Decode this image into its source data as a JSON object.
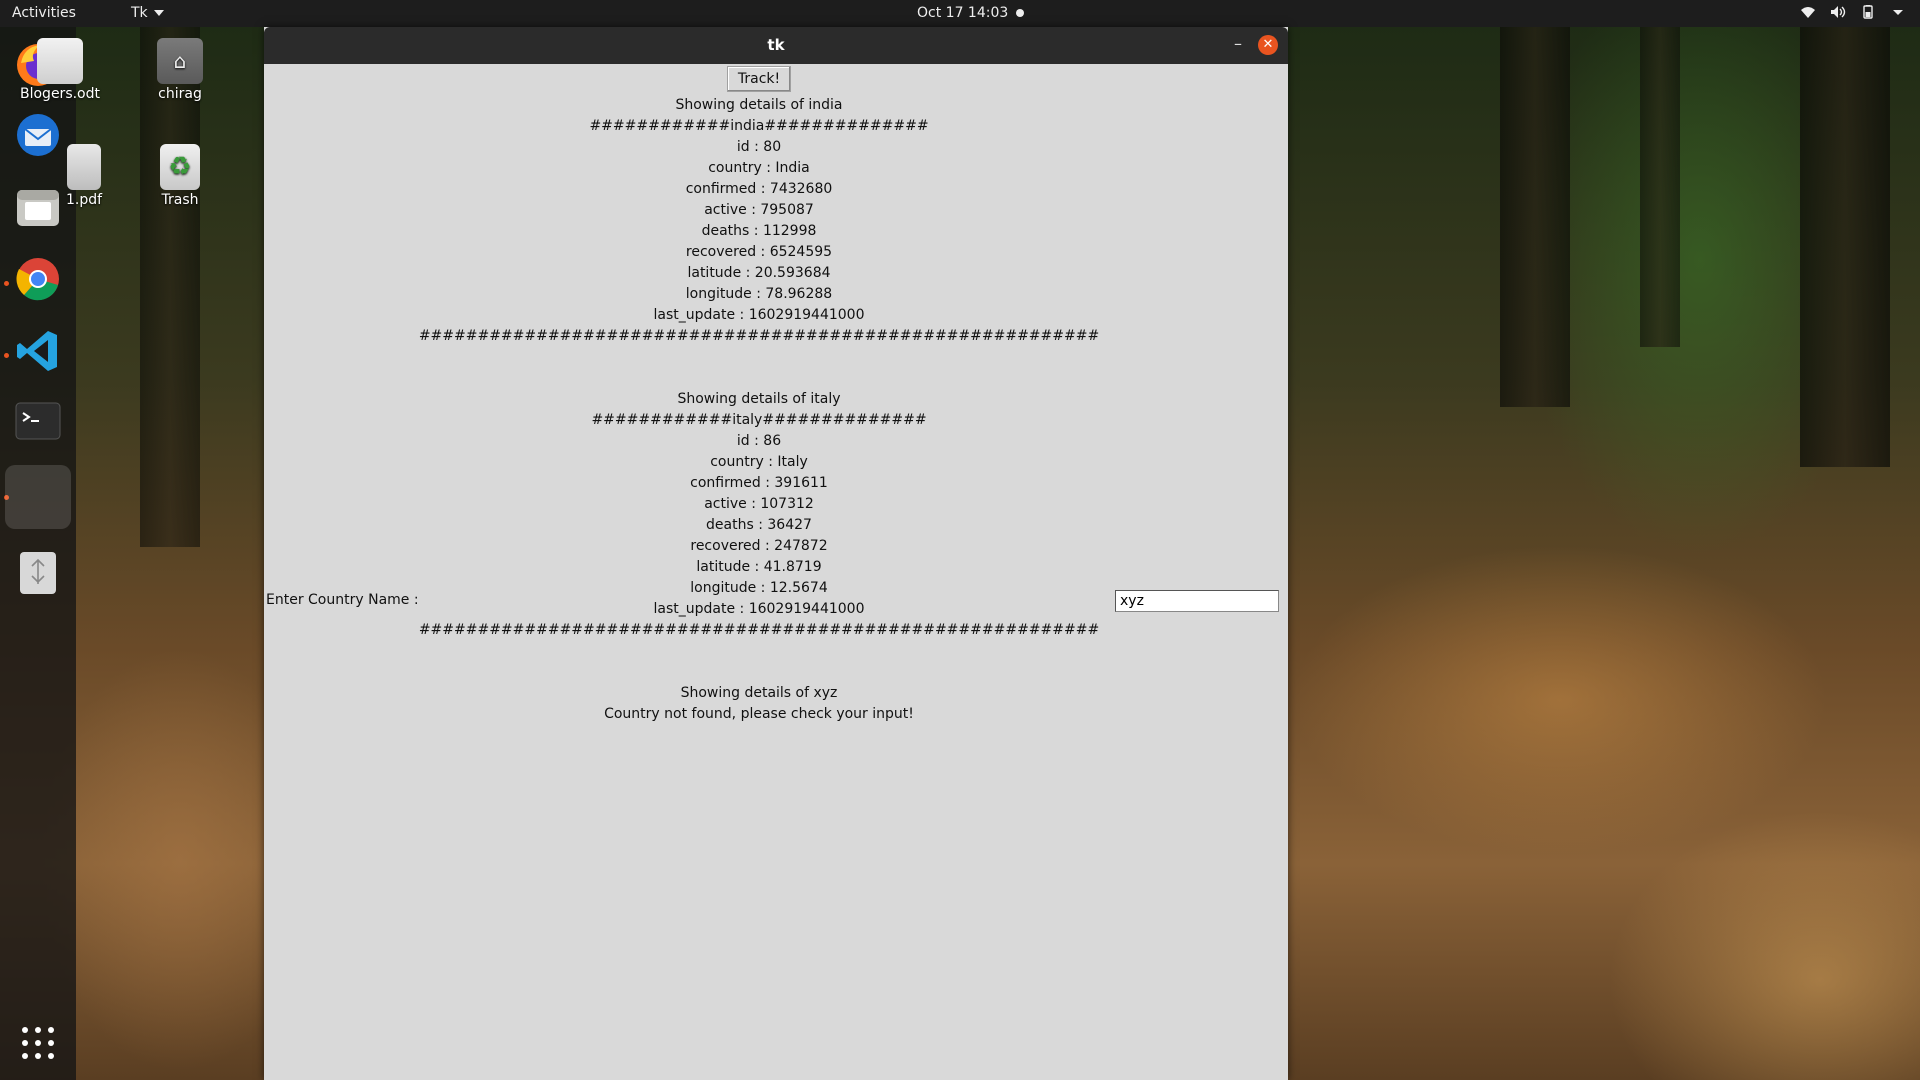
{
  "topbar": {
    "activities": "Activities",
    "app_menu": "Tk",
    "clock": "Oct 17  14:03"
  },
  "dock": {
    "items": [
      "firefox-icon",
      "thunderbird-icon",
      "files-icon",
      "chrome-icon",
      "vscode-icon",
      "terminal-icon",
      "tk-window-icon",
      "usb-drive-icon",
      "app-grid-icon"
    ]
  },
  "desktop": {
    "icons": [
      {
        "label": "Blogers.odt"
      },
      {
        "label": "chirag"
      },
      {
        "label": "1.pdf"
      },
      {
        "label": "Trash"
      }
    ]
  },
  "window": {
    "title": "tk",
    "track_button": "Track!",
    "country_label": "Enter Country Name :",
    "country_input_value": "xyz",
    "output_lines": [
      "Showing details of india",
      "############india##############",
      "id : 80",
      "country : India",
      "confirmed : 7432680",
      "active : 795087",
      "deaths : 112998",
      "recovered : 6524595",
      "latitude : 20.593684",
      "longitude : 78.96288",
      "last_update : 1602919441000",
      "##########################################################",
      "",
      "",
      "Showing details of italy",
      "############italy##############",
      "id : 86",
      "country : Italy",
      "confirmed : 391611",
      "active : 107312",
      "deaths : 36427",
      "recovered : 247872",
      "latitude : 41.8719",
      "longitude : 12.5674",
      "last_update : 1602919441000",
      "##########################################################",
      "",
      "",
      "Showing details of xyz",
      "Country not found, please check your input!"
    ]
  },
  "colors": {
    "accent": "#e95420",
    "window_bg": "#d9d9d9",
    "titlebar": "#2b2b2b"
  }
}
